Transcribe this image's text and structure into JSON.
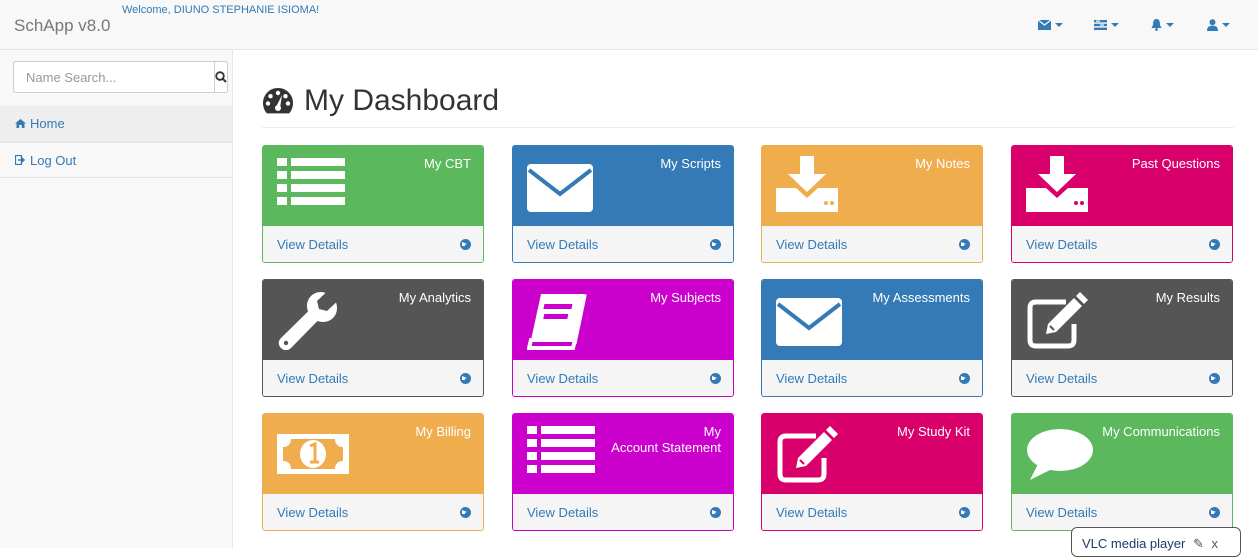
{
  "app": {
    "brand": "SchApp v8.0",
    "welcome": "Welcome, DIUNO STEPHANIE ISIOMA!"
  },
  "nav": {
    "icons": [
      "envelope-icon",
      "tasks-icon",
      "bell-icon",
      "user-icon"
    ]
  },
  "sidebar": {
    "search_placeholder": "Name Search...",
    "items": [
      {
        "label": "Home",
        "icon": "home-icon"
      },
      {
        "label": "Log Out",
        "icon": "sign-out-icon"
      }
    ]
  },
  "main": {
    "title": "My Dashboard",
    "title_icon": "dashboard-icon"
  },
  "cards": [
    {
      "label": "My CBT",
      "footer": "View Details",
      "color": "#5cb85c",
      "icon": "list-icon"
    },
    {
      "label": "My Scripts",
      "footer": "View Details",
      "color": "#337ab7",
      "icon": "envelope-icon"
    },
    {
      "label": "My Notes",
      "footer": "View Details",
      "color": "#f0ad4e",
      "icon": "download-icon"
    },
    {
      "label": "Past Questions",
      "footer": "View Details",
      "color": "#d9006c",
      "icon": "download-icon"
    },
    {
      "label": "My Analytics",
      "footer": "View Details",
      "color": "#555555",
      "icon": "wrench-icon"
    },
    {
      "label": "My Subjects",
      "footer": "View Details",
      "color": "#cc00cc",
      "icon": "book-icon"
    },
    {
      "label": "My Assessments",
      "footer": "View Details",
      "color": "#337ab7",
      "icon": "envelope-icon"
    },
    {
      "label": "My Results",
      "footer": "View Details",
      "color": "#555555",
      "icon": "edit-icon"
    },
    {
      "label": "My Billing",
      "footer": "View Details",
      "color": "#f0ad4e",
      "icon": "money-icon"
    },
    {
      "label": "My\nAccount Statement",
      "footer": "View Details",
      "color": "#cc00cc",
      "icon": "list-icon"
    },
    {
      "label": "My Study Kit",
      "footer": "View Details",
      "color": "#d9006c",
      "icon": "edit-icon"
    },
    {
      "label": "My Communications",
      "footer": "View Details",
      "color": "#5cb85c",
      "icon": "comment-icon"
    }
  ],
  "overlay": {
    "label": "VLC media player",
    "close": "x"
  }
}
